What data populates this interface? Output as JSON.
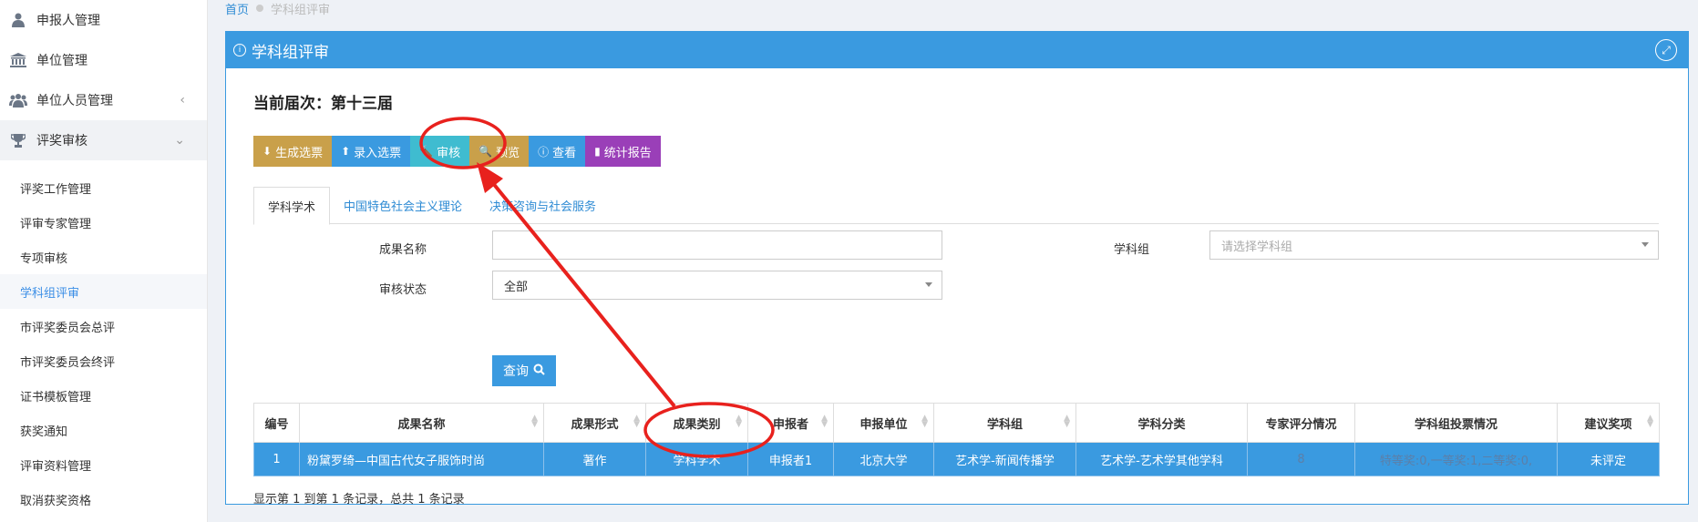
{
  "sidebar": {
    "top_items": [
      {
        "label": "申报人管理",
        "icon": "user-icon"
      },
      {
        "label": "单位管理",
        "icon": "bank-icon"
      },
      {
        "label": "单位人员管理",
        "icon": "users-icon",
        "chevron": "‹"
      },
      {
        "label": "评奖审核",
        "icon": "trophy-icon",
        "chevron": "⌄"
      }
    ],
    "sub_items": [
      {
        "label": "评奖工作管理"
      },
      {
        "label": "评审专家管理"
      },
      {
        "label": "专项审核"
      },
      {
        "label": "学科组评审",
        "active": true
      },
      {
        "label": "市评奖委员会总评"
      },
      {
        "label": "市评奖委员会终评"
      },
      {
        "label": "证书模板管理"
      },
      {
        "label": "获奖通知"
      },
      {
        "label": "评审资料管理"
      },
      {
        "label": "取消获奖资格"
      }
    ]
  },
  "breadcrumb": {
    "home": "首页",
    "current": "学科组评审"
  },
  "panel": {
    "title": "学科组评审",
    "round_label": "当前届次：第十三届",
    "buttons": [
      {
        "label": "生成选票",
        "icon": "download-icon",
        "color": "#c9a04a"
      },
      {
        "label": "录入选票",
        "icon": "upload-icon",
        "color": "#3a9ae0"
      },
      {
        "label": "审核",
        "icon": "gavel-icon",
        "color": "#3fbcd0"
      },
      {
        "label": "预览",
        "icon": "search-icon",
        "color": "#c9a04a"
      },
      {
        "label": "查看",
        "icon": "info-icon",
        "color": "#3a9ae0"
      },
      {
        "label": "统计报告",
        "icon": "bar-chart-icon",
        "color": "#9a3fb8"
      }
    ],
    "tabs": [
      {
        "label": "学科学术",
        "active": true
      },
      {
        "label": "中国特色社会主义理论"
      },
      {
        "label": "决策咨询与社会服务"
      }
    ],
    "filters": {
      "name_label": "成果名称",
      "name_value": "",
      "group_label": "学科组",
      "group_placeholder": "请选择学科组",
      "status_label": "审核状态",
      "status_value": "全部",
      "query_label": "查询"
    },
    "table": {
      "headers": [
        "编号",
        "成果名称",
        "成果形式",
        "成果类别",
        "申报者",
        "申报单位",
        "学科组",
        "学科分类",
        "专家评分情况",
        "学科组投票情况",
        "建议奖项"
      ],
      "rows": [
        [
          "1",
          "粉黛罗绮—中国古代女子服饰时尚",
          "著作",
          "学科学术",
          "申报者1",
          "北京大学",
          "艺术学-新闻传播学",
          "艺术学-艺术学其他学科",
          "8",
          "特等奖:0,一等奖:1,二等奖:0,",
          "未评定"
        ]
      ]
    },
    "summary": "显示第 1 到第 1 条记录，总共 1 条记录"
  },
  "colors": {
    "primary": "#3a9ae0",
    "annotation": "#e8211d"
  }
}
